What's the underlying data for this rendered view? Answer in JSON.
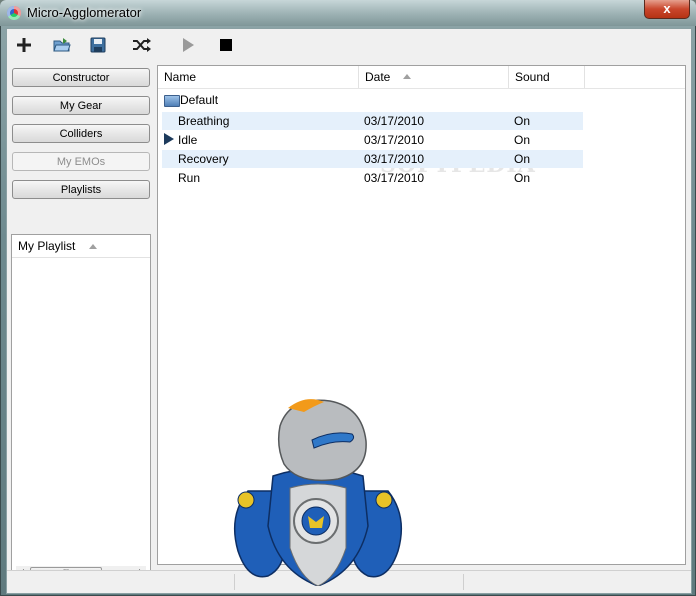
{
  "window": {
    "title": "Micro-Agglomerator",
    "close_label": "x"
  },
  "toolbar": {
    "buttons": [
      {
        "name": "add",
        "icon": "plus-icon"
      },
      {
        "name": "open",
        "icon": "open-folder-icon"
      },
      {
        "name": "save",
        "icon": "save-icon"
      },
      {
        "name": "shuffle",
        "icon": "shuffle-icon"
      },
      {
        "name": "play",
        "icon": "play-icon"
      },
      {
        "name": "stop",
        "icon": "stop-icon"
      }
    ]
  },
  "sidebar": {
    "buttons": [
      {
        "label": "Constructor",
        "enabled": true
      },
      {
        "label": "My Gear",
        "enabled": true
      },
      {
        "label": "Colliders",
        "enabled": true
      },
      {
        "label": "My EMOs",
        "enabled": false
      },
      {
        "label": "Playlists",
        "enabled": true
      }
    ],
    "playlist_header": "My Playlist",
    "scroll_grip": "III"
  },
  "list": {
    "columns": {
      "name": "Name",
      "date": "Date",
      "sound": "Sound"
    },
    "folder": "Default",
    "rows": [
      {
        "name": "Breathing",
        "date": "03/17/2010",
        "sound": "On",
        "highlighted": true,
        "playing": false
      },
      {
        "name": "Idle",
        "date": "03/17/2010",
        "sound": "On",
        "highlighted": false,
        "playing": true
      },
      {
        "name": "Recovery",
        "date": "03/17/2010",
        "sound": "On",
        "highlighted": true,
        "playing": false
      },
      {
        "name": "Run",
        "date": "03/17/2010",
        "sound": "On",
        "highlighted": false,
        "playing": false
      }
    ],
    "watermark": "SOFTPEDIA"
  },
  "colors": {
    "highlight_row": "#e5f0fb",
    "robot_blue": "#1f5fb8",
    "robot_grey": "#b9bcbf",
    "robot_orange": "#f29a1a"
  }
}
